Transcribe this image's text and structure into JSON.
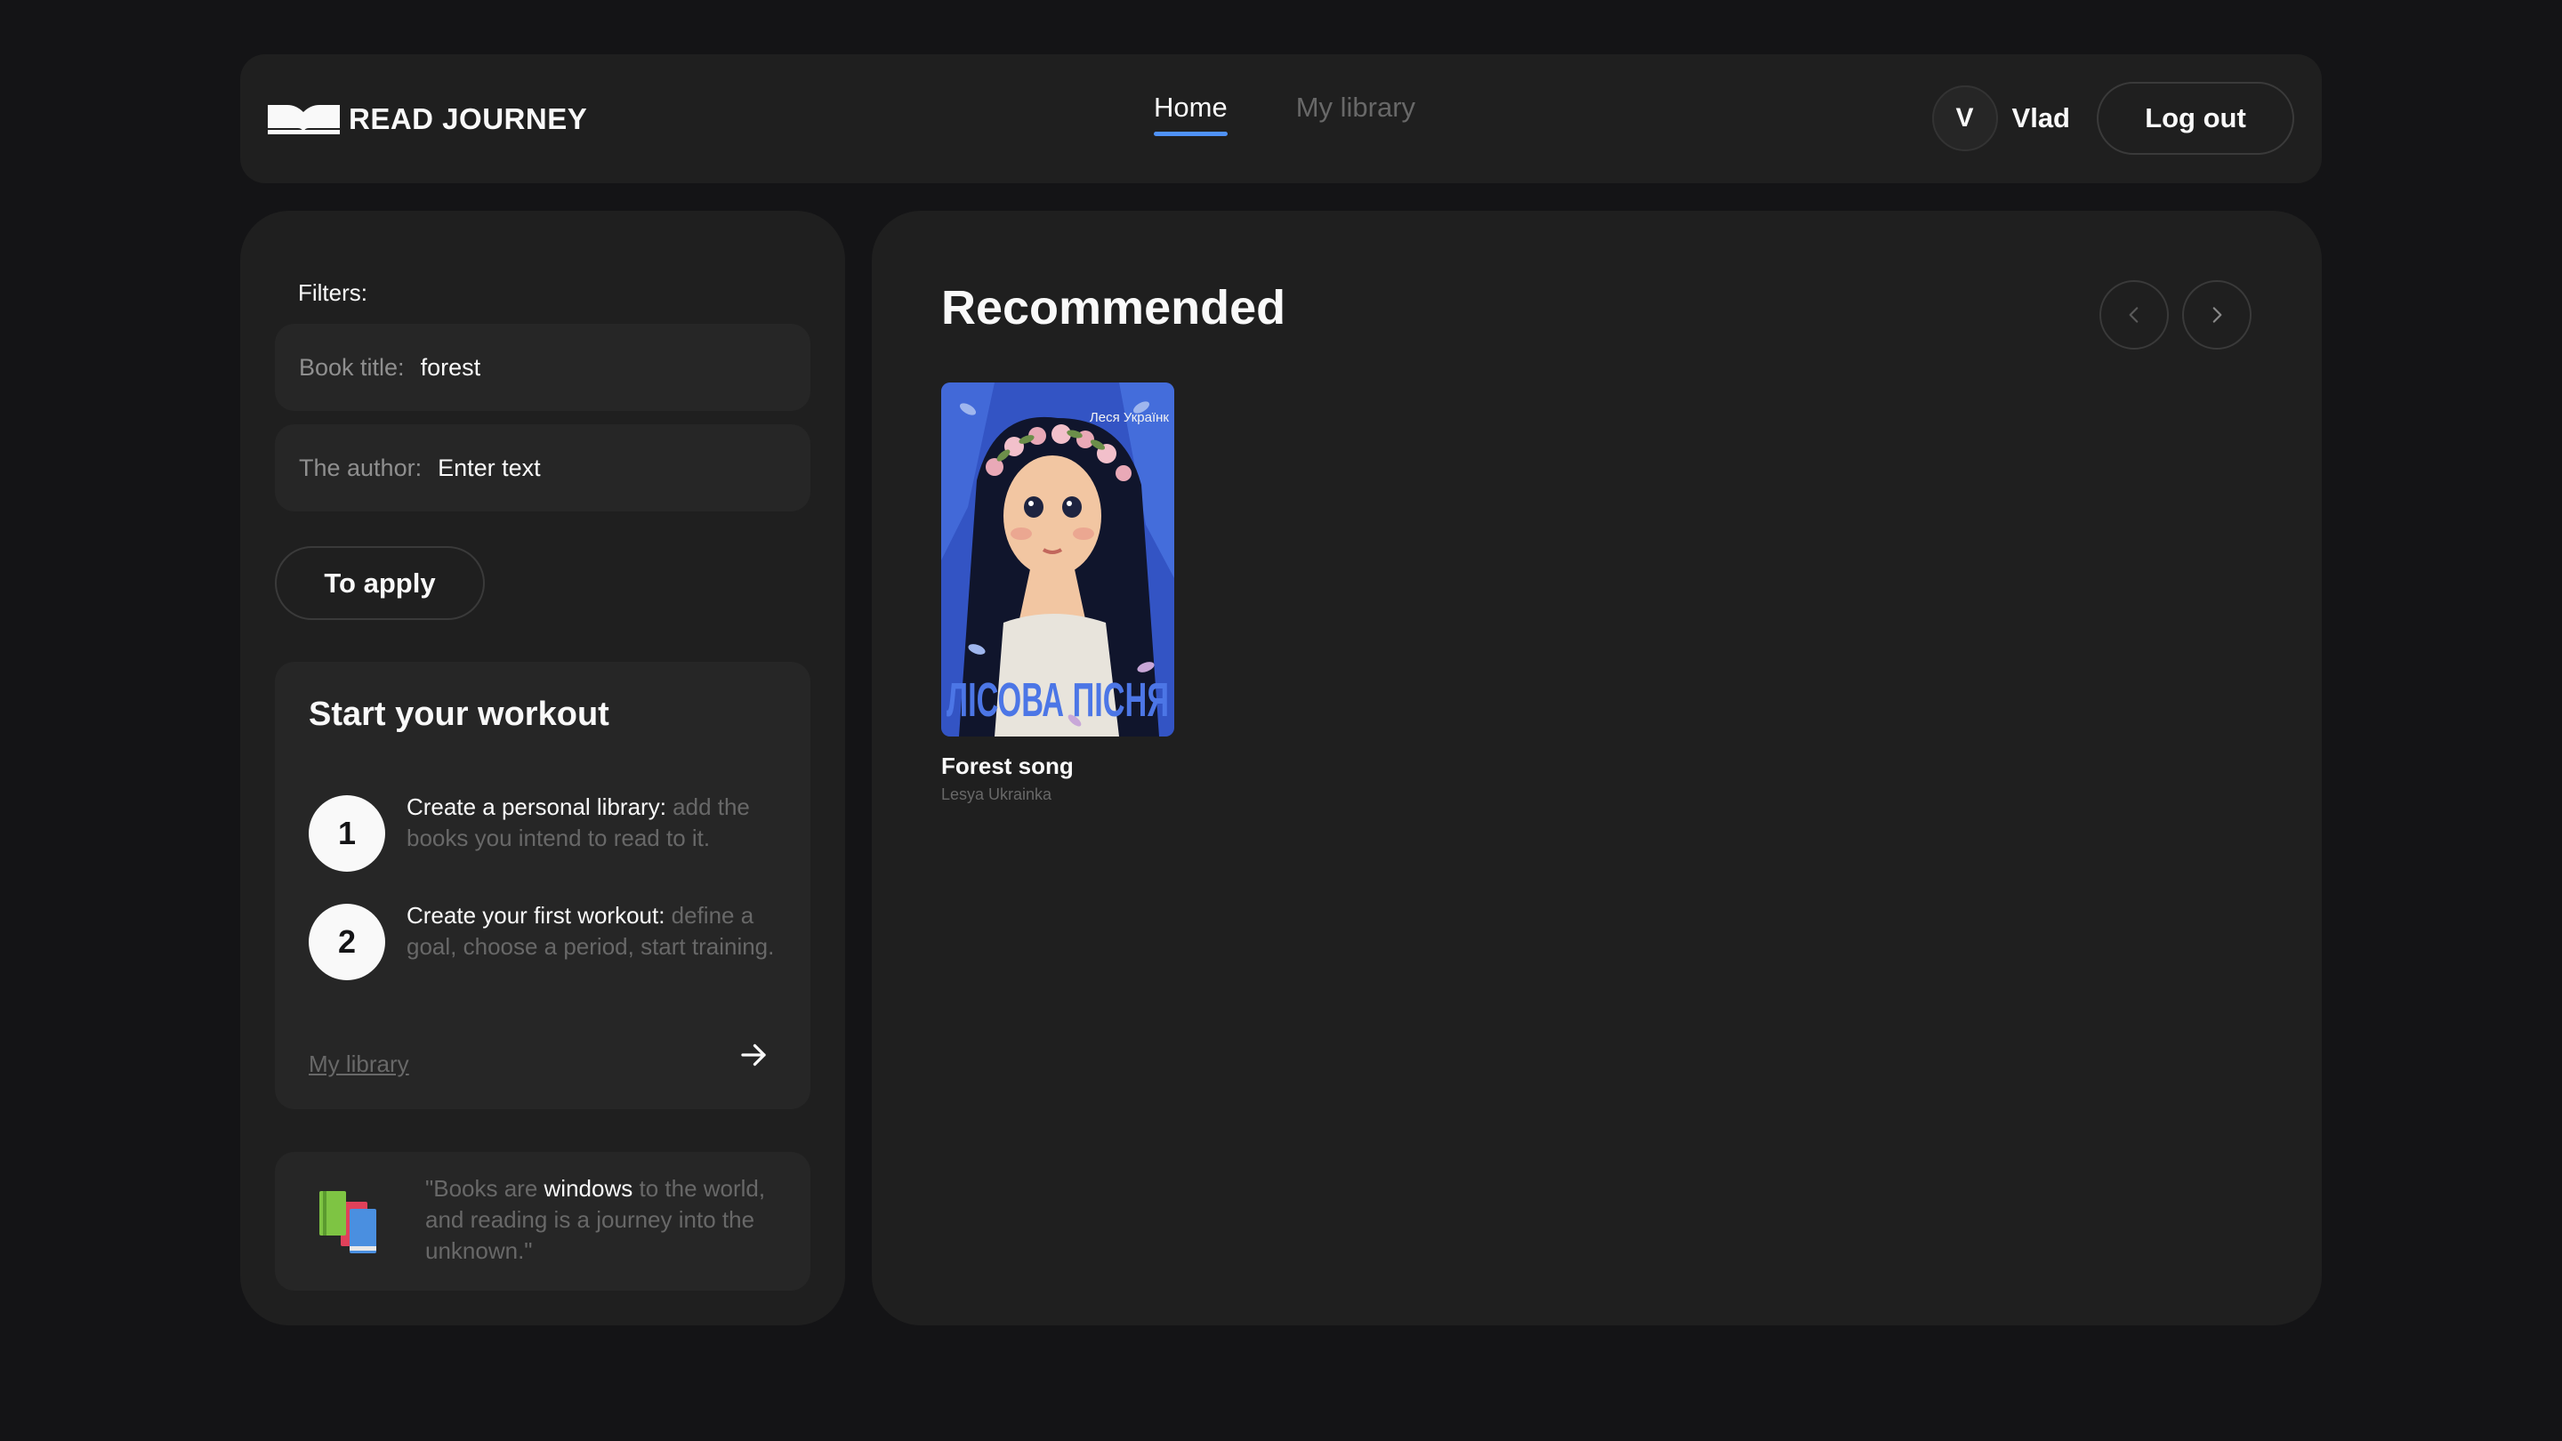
{
  "header": {
    "logo_text": "READ JOURNEY",
    "nav": [
      {
        "label": "Home",
        "active": true
      },
      {
        "label": "My library",
        "active": false
      }
    ],
    "user": {
      "initial": "V",
      "name": "Vlad"
    },
    "logout_label": "Log out"
  },
  "filters": {
    "label": "Filters:",
    "book_title": {
      "label": "Book title:",
      "value": "forest"
    },
    "author": {
      "label": "The author:",
      "placeholder": "Enter text"
    },
    "apply_label": "To apply"
  },
  "workout": {
    "title": "Start your workout",
    "steps": [
      {
        "number": "1",
        "strong": "Create a personal library:",
        "text": " add the books you intend to read to it."
      },
      {
        "number": "2",
        "strong": "Create your first workout:",
        "text": " define a goal, choose a period, start training."
      }
    ],
    "link_label": "My library"
  },
  "quote": {
    "before": "\"Books are ",
    "strong": "windows",
    "after": " to the world, and reading is a journey into the unknown.\""
  },
  "recommended": {
    "title": "Recommended",
    "books": [
      {
        "title": "Forest song",
        "author": "Lesya Ukrainka",
        "cover_top_text": "Леся Українк",
        "cover_bottom_text": "ЛІСОВА ПІСНЯ"
      }
    ]
  },
  "colors": {
    "background": "#141416",
    "panel": "#1f1f1f",
    "field": "#262626",
    "text_primary": "#f9f9f9",
    "text_secondary": "#686868",
    "accent": "#4f92f7"
  }
}
